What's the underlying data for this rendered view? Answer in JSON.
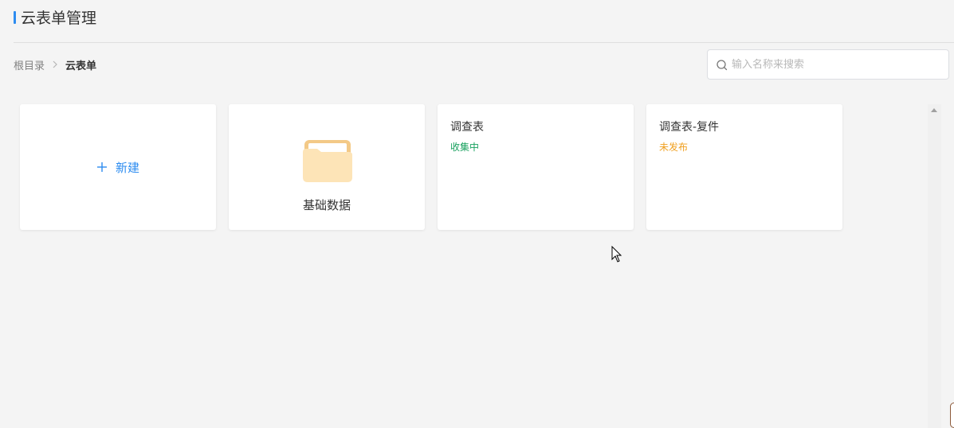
{
  "header": {
    "title": "云表单管理",
    "accent_color": "#2d8cf0"
  },
  "breadcrumb": {
    "items": [
      {
        "label": "根目录"
      },
      {
        "label": "云表单"
      }
    ],
    "separator_icon": "chevron-right-icon"
  },
  "search": {
    "placeholder": "输入名称来搜索",
    "value": "",
    "icon": "search-icon"
  },
  "cards": {
    "new": {
      "label": "新建",
      "icon": "plus-icon",
      "color": "#2d8cf0"
    },
    "folder": {
      "label": "基础数据",
      "icon": "folder-icon"
    },
    "forms": [
      {
        "name": "调查表",
        "status": "收集中",
        "status_color": "#19a15f"
      },
      {
        "name": "调查表-复件",
        "status": "未发布",
        "status_color": "#f0a020"
      }
    ]
  },
  "scrollbar": {
    "icon": "scroll-up-arrow-icon"
  }
}
